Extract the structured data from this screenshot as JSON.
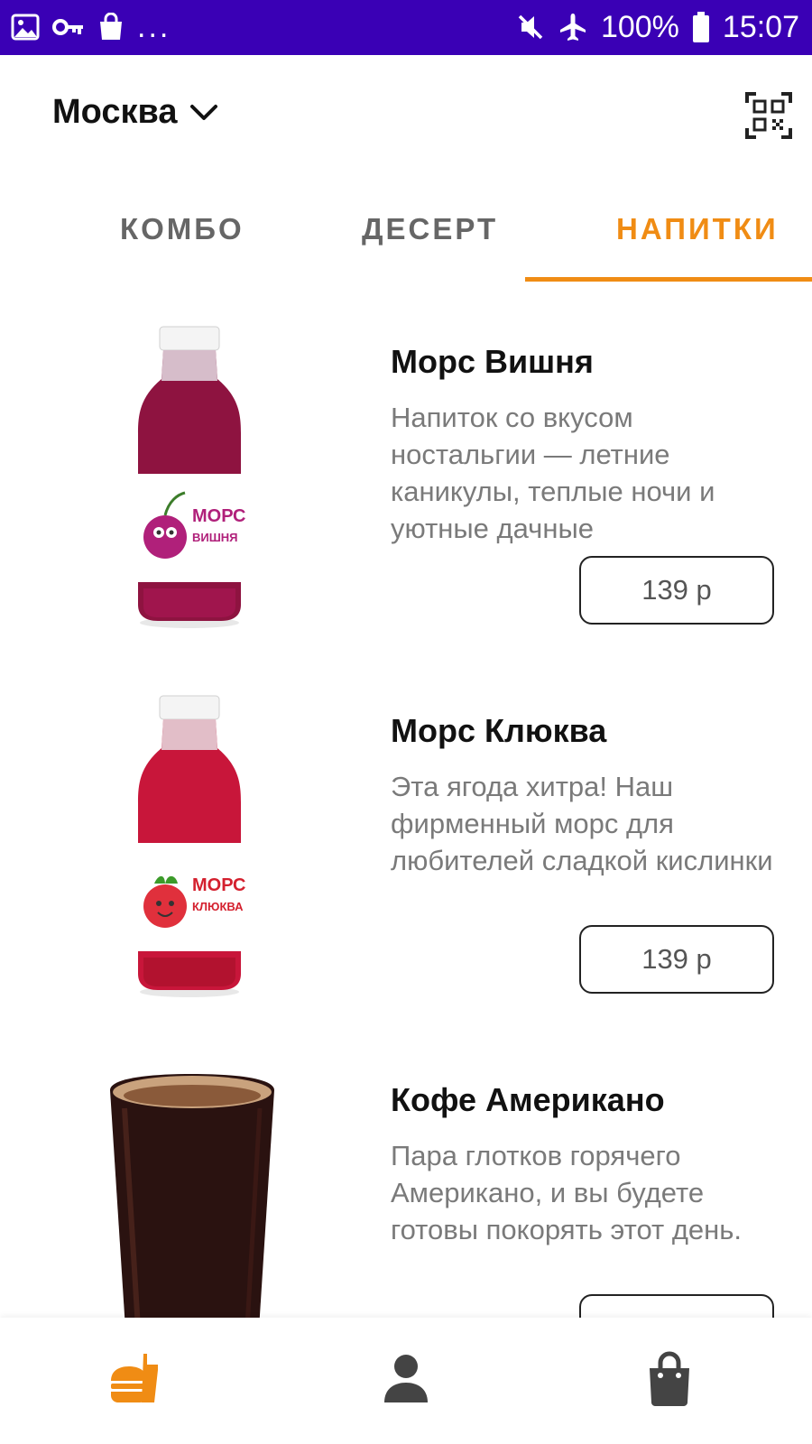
{
  "status_bar": {
    "battery_text": "100%",
    "time": "15:07",
    "dots": "..."
  },
  "header": {
    "city": "Москва"
  },
  "tabs": [
    {
      "label": "КОМБО",
      "active": false
    },
    {
      "label": "ДЕСЕРТ",
      "active": false
    },
    {
      "label": "НАПИТКИ",
      "active": true
    }
  ],
  "products": [
    {
      "title": "Морс Вишня",
      "description": "Напиток со вкусом ностальгии — летние каникулы, теплые ночи и уютные дачные",
      "price": "139 р"
    },
    {
      "title": "Морс Клюква",
      "description": "Эта ягода хитра! Наш фирменный морс для любителей сладкой кислинки",
      "price": "139 р"
    },
    {
      "title": "Кофе Американо",
      "description": "Пара глотков горячего Американо, и вы будете готовы покорять этот день.",
      "price": ""
    }
  ],
  "bottom_nav": [
    {
      "icon": "burger-icon",
      "active": true
    },
    {
      "icon": "profile-icon",
      "active": false
    },
    {
      "icon": "bag-icon",
      "active": false
    }
  ],
  "colors": {
    "status_bar": "#3a00b5",
    "accent": "#f08c14",
    "text": "#111111",
    "secondary_text": "#7a7a7a"
  }
}
